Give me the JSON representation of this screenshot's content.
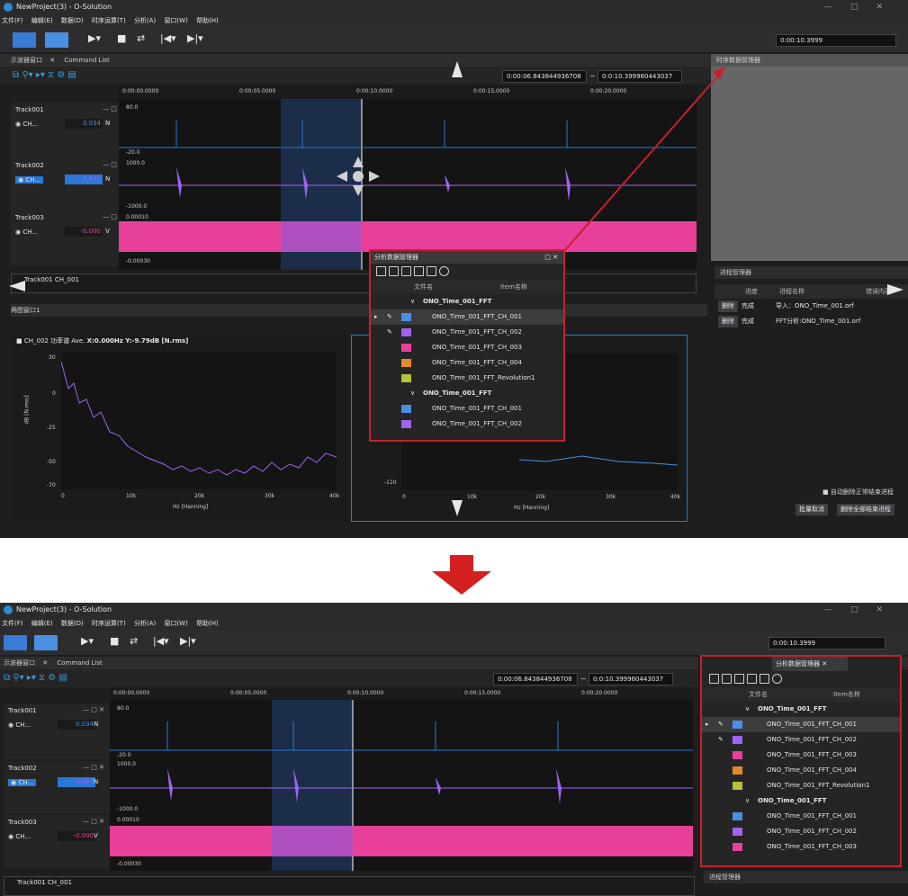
{
  "app_title": "NewProject(3) - O-Solution",
  "menu": [
    "文件(F)",
    "编辑(E)",
    "数据(D)",
    "时序运算(T)",
    "分析(A)",
    "窗口(W)",
    "帮助(H)"
  ],
  "toolbar": {
    "time_display": "0:00:10.3999"
  },
  "tabs": {
    "scope_window": "示波器窗口",
    "command_list": "Command List",
    "timeseries_mgr": "时序数据管理器",
    "analysis_mgr": "分析数据管理器",
    "process_mgr": "进程管理器",
    "graph_window": "两图窗口1"
  },
  "range": {
    "start": "0:00:06.843844936708",
    "sep": "~",
    "end": "0:0:10.399960443037"
  },
  "ruler": [
    "0:00:00.0000",
    "0:00:05.0000",
    "0:00:10.0000",
    "0:00:15.0000",
    "0:00:20.0000"
  ],
  "tracks": [
    {
      "name": "Track001",
      "ch": "CH...",
      "value": "0.034",
      "unit": "N",
      "top": "80.0",
      "bottom": "-20.0"
    },
    {
      "name": "Track002",
      "ch": "CH...",
      "value": "0.047",
      "unit": "N",
      "top": "1000.0",
      "bottom": "-1000.0"
    },
    {
      "name": "Track003",
      "ch": "CH...",
      "value": "-0.000",
      "unit": "V",
      "top": "0.00010",
      "bottom": "-0.00030"
    }
  ],
  "overview_label": "Track001 CH_001",
  "graph": {
    "legend": "CH_002  功率谱  Ave.",
    "readout": "X:0.000Hz Y:-9.79dB [N.rms]",
    "ylabel": "dB [N.rms]",
    "xlabel": "Hz [Hanning]",
    "yticks": [
      "30",
      "0",
      "-25",
      "-50",
      "-70"
    ],
    "xticks": [
      "0",
      "10k",
      "20k",
      "30k",
      "40k"
    ],
    "right_yticks": [
      "-110"
    ],
    "right_xticks": [
      "0",
      "10k",
      "20k",
      "30k",
      "40k"
    ]
  },
  "analysis_dialog": {
    "title": "分析数据管理器",
    "col_file": "文件名",
    "col_item": "Item名称",
    "rows": [
      {
        "kind": "group",
        "label": "ONO_Time_001_FFT"
      },
      {
        "kind": "item",
        "label": "ONO_Time_001_FFT_CH_001",
        "color": "#4a90e2",
        "pin": true,
        "selected": true
      },
      {
        "kind": "item",
        "label": "ONO_Time_001_FFT_CH_002",
        "color": "#a064f0",
        "pin": true
      },
      {
        "kind": "item",
        "label": "ONO_Time_001_FFT_CH_003",
        "color": "#e8409a"
      },
      {
        "kind": "item",
        "label": "ONO_Time_001_FFT_CH_004",
        "color": "#e08a2a"
      },
      {
        "kind": "item",
        "label": "ONO_Time_001_FFT_Revolution1",
        "color": "#b5c23a"
      },
      {
        "kind": "group",
        "label": "ONO_Time_001_FFT"
      },
      {
        "kind": "item",
        "label": "ONO_Time_001_FFT_CH_001",
        "color": "#4a90e2"
      },
      {
        "kind": "item",
        "label": "ONO_Time_001_FFT_CH_002",
        "color": "#a064f0"
      }
    ]
  },
  "docked_rows": [
    {
      "kind": "group",
      "label": "ONO_Time_001_FFT"
    },
    {
      "kind": "item",
      "label": "ONO_Time_001_FFT_CH_001",
      "color": "#4a90e2",
      "pin": true,
      "selected": true
    },
    {
      "kind": "item",
      "label": "ONO_Time_001_FFT_CH_002",
      "color": "#a064f0",
      "pin": true
    },
    {
      "kind": "item",
      "label": "ONO_Time_001_FFT_CH_003",
      "color": "#e8409a"
    },
    {
      "kind": "item",
      "label": "ONO_Time_001_FFT_CH_004",
      "color": "#e08a2a"
    },
    {
      "kind": "item",
      "label": "ONO_Time_001_FFT_Revolution1",
      "color": "#b5c23a"
    },
    {
      "kind": "group",
      "label": "ONO_Time_001_FFT"
    },
    {
      "kind": "item",
      "label": "ONO_Time_001_FFT_CH_001",
      "color": "#4a90e2"
    },
    {
      "kind": "item",
      "label": "ONO_Time_001_FFT_CH_002",
      "color": "#a064f0"
    },
    {
      "kind": "item",
      "label": "ONO_Time_001_FFT_CH_003",
      "color": "#e8409a"
    }
  ],
  "process": {
    "col_progress": "进度",
    "col_name": "进程名称",
    "col_error": "错误内容",
    "rows": [
      {
        "btn": "删除",
        "status": "完成",
        "name": "导入：ONO_Time_001.orf"
      },
      {
        "btn": "删除",
        "status": "完成",
        "name": "FFT分析:ONO_Time_001.orf"
      }
    ],
    "auto_delete": "自动删除正常结束进程",
    "cancel_all": "批量取消",
    "delete_all": "删除全部结束进程"
  }
}
